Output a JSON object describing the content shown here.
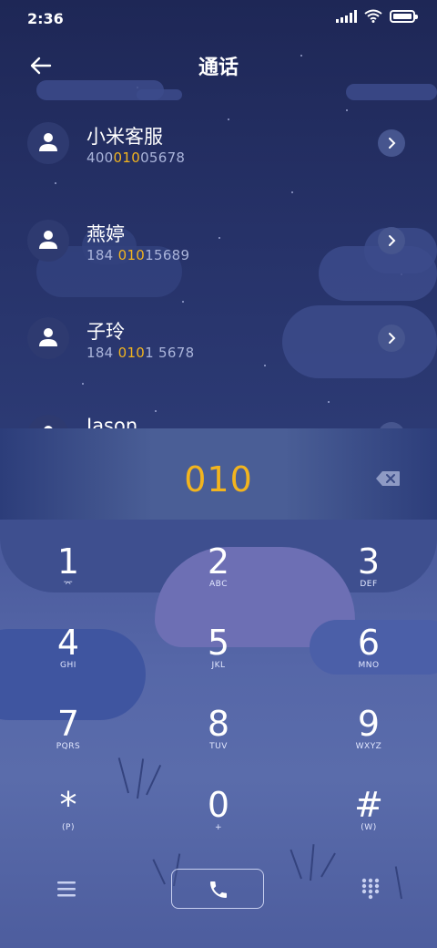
{
  "status_bar": {
    "time": "2:36"
  },
  "header": {
    "title": "通话"
  },
  "contacts": [
    {
      "name": "小米客服",
      "number_pre": "400",
      "number_hl": "010",
      "number_post": "05678"
    },
    {
      "name": "燕婷",
      "number_pre": "184 ",
      "number_hl": "010",
      "number_post": "15689"
    },
    {
      "name": "子玲",
      "number_pre": "184 ",
      "number_hl": "010",
      "number_post": "1 5678"
    },
    {
      "name": "Jason",
      "number_pre": "",
      "number_hl": "",
      "number_post": ""
    }
  ],
  "dialer": {
    "input_value": "010"
  },
  "keypad": {
    "keys": [
      {
        "digit": "1",
        "letters": "⌤"
      },
      {
        "digit": "2",
        "letters": "ABC"
      },
      {
        "digit": "3",
        "letters": "DEF"
      },
      {
        "digit": "4",
        "letters": "GHI"
      },
      {
        "digit": "5",
        "letters": "JKL"
      },
      {
        "digit": "6",
        "letters": "MNO"
      },
      {
        "digit": "7",
        "letters": "PQRS"
      },
      {
        "digit": "8",
        "letters": "TUV"
      },
      {
        "digit": "9",
        "letters": "WXYZ"
      },
      {
        "digit": "*",
        "letters": "(P)"
      },
      {
        "digit": "0",
        "letters": "+"
      },
      {
        "digit": "#",
        "letters": "(W)"
      }
    ]
  },
  "colors": {
    "highlight": "#f2b41e",
    "sky": "#1e2756",
    "keypad_bg": "#5667a8"
  },
  "icons": [
    "back-arrow-icon",
    "person-icon",
    "chevron-right-icon",
    "backspace-icon",
    "menu-icon",
    "phone-icon",
    "dialpad-icon"
  ]
}
